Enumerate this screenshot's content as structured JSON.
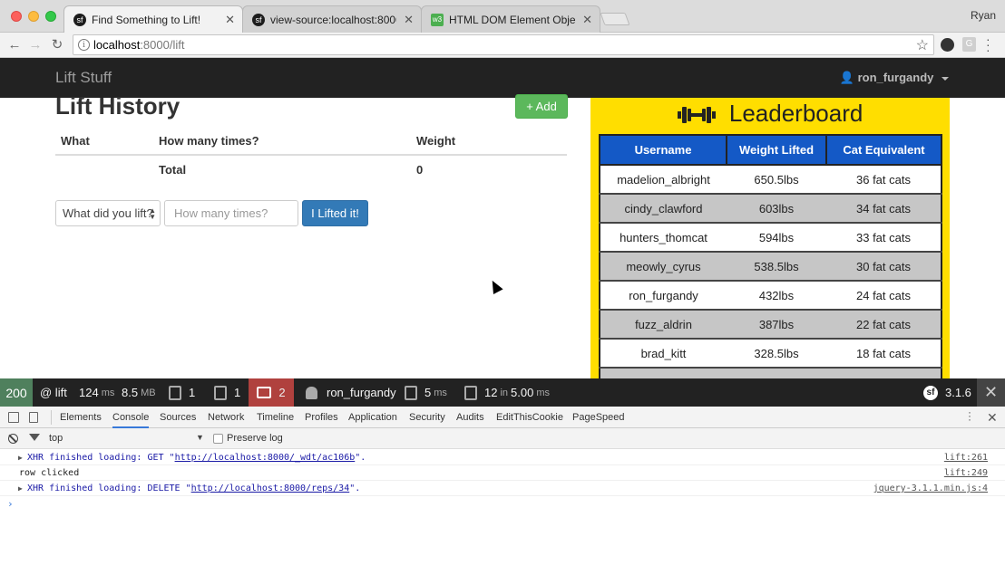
{
  "browser": {
    "tabs": [
      {
        "title": "Find Something to Lift!",
        "icon": "symfony-icon",
        "glyph": "sf"
      },
      {
        "title": "view-source:localhost:8000/lift",
        "icon": "symfony-icon",
        "glyph": "sf"
      },
      {
        "title": "HTML DOM Element Objects",
        "icon": "w3schools-icon",
        "glyph": "w3"
      }
    ],
    "profile": "Ryan",
    "url_host": "localhost",
    "url_rest": ":8000/lift"
  },
  "app": {
    "brand": "Lift Stuff",
    "user": "ron_furgandy",
    "history_title": "Lift History",
    "add_button": "+ Add",
    "table": {
      "headers": [
        "What",
        "How many times?",
        "Weight"
      ],
      "total_label": "Total",
      "total_value": "0"
    },
    "form": {
      "select_value": "What did you lift?",
      "reps_placeholder": "How many times?",
      "submit": "I Lifted it!"
    }
  },
  "leaderboard": {
    "title": "Leaderboard",
    "headers": [
      "Username",
      "Weight Lifted",
      "Cat Equivalent"
    ],
    "rows": [
      [
        "madelion_albright",
        "650.5lbs",
        "36 fat cats"
      ],
      [
        "cindy_clawford",
        "603lbs",
        "34 fat cats"
      ],
      [
        "hunters_thomcat",
        "594lbs",
        "33 fat cats"
      ],
      [
        "meowly_cyrus",
        "538.5lbs",
        "30 fat cats"
      ],
      [
        "ron_furgandy",
        "432lbs",
        "24 fat cats"
      ],
      [
        "fuzz_aldrin",
        "387lbs",
        "22 fat cats"
      ],
      [
        "brad_kitt",
        "328.5lbs",
        "18 fat cats"
      ]
    ],
    "colors": {
      "background": "#ffde00",
      "header": "#1459c6",
      "stripe": "#c6c6c6"
    }
  },
  "profiler": {
    "status": "200",
    "route": "@ lift",
    "time_value": "124",
    "time_unit": "ms",
    "memory_value": "8.5",
    "memory_unit": "MB",
    "forms": "1",
    "logs": "1",
    "errors": "2",
    "user": "ron_furgandy",
    "twig_value": "5",
    "twig_unit": "ms",
    "db_queries": "12",
    "db_in": "in",
    "db_time": "5.00",
    "db_unit": "ms",
    "version": "3.1.6",
    "status_color": "#4f805d",
    "error_color": "#b0413e"
  },
  "devtools": {
    "tabs": [
      "Elements",
      "Console",
      "Sources",
      "Network",
      "Timeline",
      "Profiles",
      "Application",
      "Security",
      "Audits",
      "EditThisCookie",
      "PageSpeed"
    ],
    "active_tab": "Console",
    "context": "top",
    "preserve_log": "Preserve log",
    "lines": [
      {
        "prefix": "XHR finished loading: GET \"",
        "url": "http://localhost:8000/_wdt/ac106b",
        "suffix": "\".",
        "source": "lift:261"
      },
      {
        "text": "row clicked",
        "source": "lift:249"
      },
      {
        "prefix": "XHR finished loading: DELETE \"",
        "url": "http://localhost:8000/reps/34",
        "suffix": "\".",
        "source": "jquery-3.1.1.min.js:4"
      }
    ],
    "prompt": "›"
  }
}
